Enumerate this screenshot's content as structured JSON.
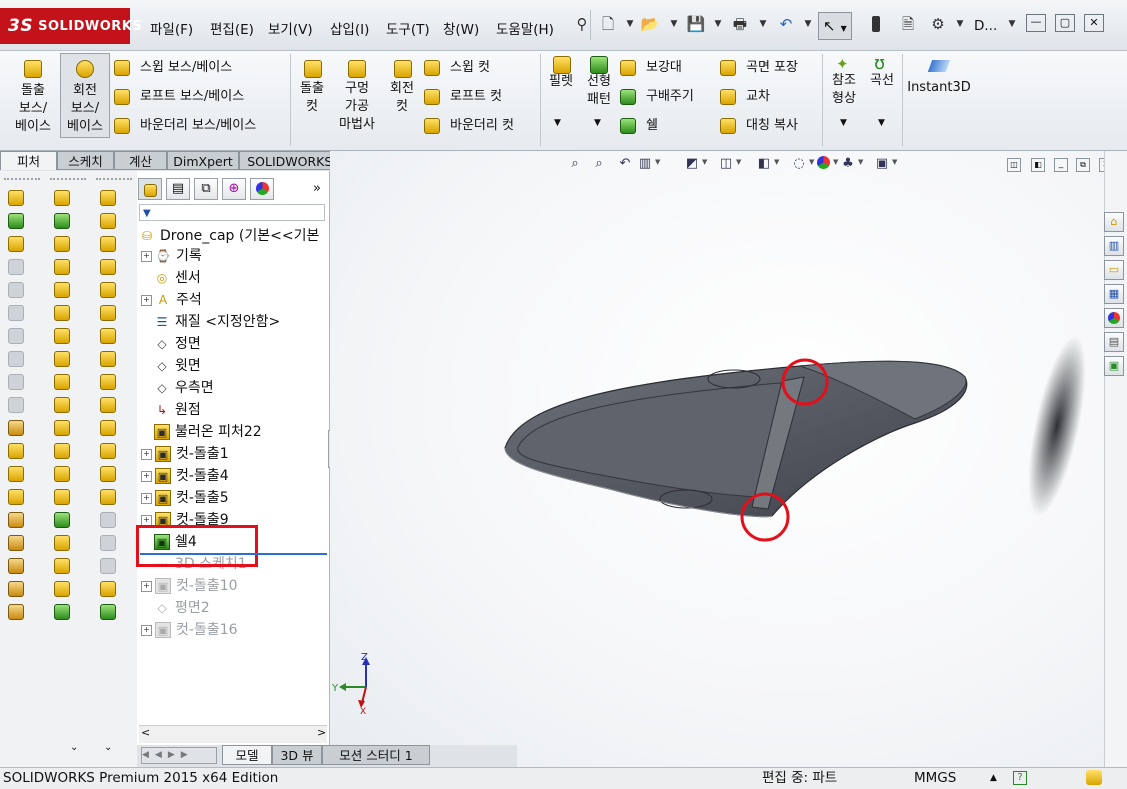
{
  "app": {
    "logo_text": "SOLIDWORKS",
    "doc_title_short": "D...",
    "brand_color": "#c4121a"
  },
  "menu": [
    "파일(F)",
    "편집(E)",
    "보기(V)",
    "삽입(I)",
    "도구(T)",
    "창(W)",
    "도움말(H)"
  ],
  "ribbon": {
    "boss_extrude": "돌출\n보스/\n베이스",
    "boss_revolve": "회전\n보스/\n베이스",
    "sweep_boss": "스윕 보스/베이스",
    "loft_boss": "로프트 보스/베이스",
    "boundary_boss": "바운더리 보스/베이스",
    "cut_extrude": "돌출\n컷",
    "hole_wizard": "구멍\n가공\n마법사",
    "cut_revolve": "회전\n컷",
    "sweep_cut": "스윕 컷",
    "loft_cut": "로프트 컷",
    "boundary_cut": "바운더리 컷",
    "fillet": "필렛",
    "linear_pattern": "선형\n패턴",
    "rib": "보강대",
    "draft": "구배주기",
    "shell": "쉘",
    "wrap": "곡면 포장",
    "intersect": "교차",
    "mirror": "대칭 복사",
    "ref_geometry": "참조\n형상",
    "curves": "곡선",
    "instant3d": "Instant3D"
  },
  "feature_tabs": [
    "피처",
    "스케치",
    "계산",
    "DimXpert",
    "SOLIDWORKS 애드인"
  ],
  "tree": {
    "root": "Drone_cap  (기본<<기본",
    "items": [
      {
        "label": "기록",
        "icon": "history-icon",
        "expand": true,
        "dim": false
      },
      {
        "label": "센서",
        "icon": "sensor-icon",
        "expand": false,
        "dim": false
      },
      {
        "label": "주석",
        "icon": "annotation-icon",
        "expand": true,
        "dim": false
      },
      {
        "label": "재질 <지정안함>",
        "icon": "material-icon",
        "expand": false,
        "dim": false
      },
      {
        "label": "정면",
        "icon": "plane-icon",
        "expand": false,
        "dim": false
      },
      {
        "label": "윗면",
        "icon": "plane-icon",
        "expand": false,
        "dim": false
      },
      {
        "label": "우측면",
        "icon": "plane-icon",
        "expand": false,
        "dim": false
      },
      {
        "label": "원점",
        "icon": "origin-icon",
        "expand": false,
        "dim": false
      },
      {
        "label": "불러온 피처22",
        "icon": "imported-feature-icon",
        "expand": false,
        "dim": false
      },
      {
        "label": "컷-돌출1",
        "icon": "cut-extrude-icon",
        "expand": true,
        "dim": false
      },
      {
        "label": "컷-돌출4",
        "icon": "cut-extrude-icon",
        "expand": true,
        "dim": false
      },
      {
        "label": "컷-돌출5",
        "icon": "cut-extrude-icon",
        "expand": true,
        "dim": false
      },
      {
        "label": "컷-돌출9",
        "icon": "cut-extrude-icon",
        "expand": true,
        "dim": false
      },
      {
        "label": "쉘4",
        "icon": "shell-icon",
        "expand": false,
        "dim": false
      },
      {
        "label": "3D 스케치1",
        "icon": "3d-sketch-icon",
        "expand": false,
        "dim": true
      },
      {
        "label": "컷-돌출10",
        "icon": "cut-extrude-icon",
        "expand": true,
        "dim": true
      },
      {
        "label": "평면2",
        "icon": "plane-icon",
        "expand": false,
        "dim": true
      },
      {
        "label": "컷-돌출16",
        "icon": "cut-extrude-icon",
        "expand": true,
        "dim": true
      }
    ]
  },
  "bottom_tabs": [
    "모델",
    "3D 뷰",
    "모션 스터디 1"
  ],
  "status": {
    "edition": "SOLIDWORKS Premium 2015 x64 Edition",
    "mode": "편집 중: 파트",
    "units": "MMGS"
  },
  "axes": {
    "y": "Y",
    "z": "Z",
    "x": "X"
  },
  "colors": {
    "highlight": "#e3101b",
    "part": "#5a5d66"
  }
}
